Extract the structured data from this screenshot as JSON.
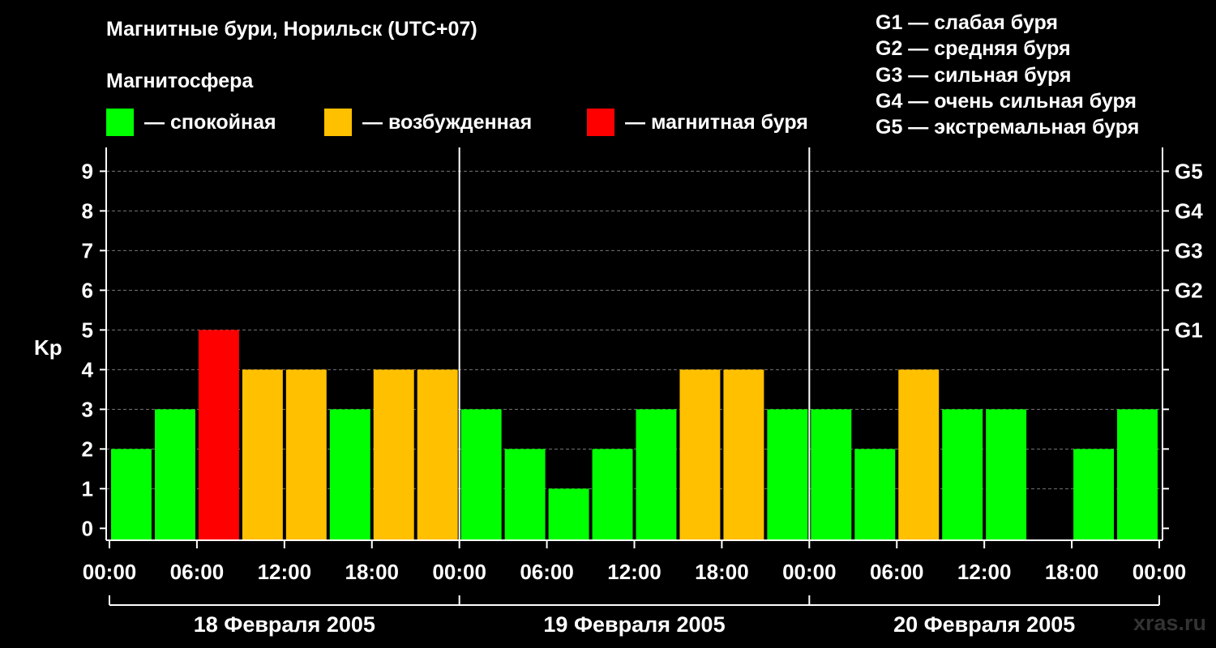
{
  "title": "Магнитные бури, Норильск (UTC+07)",
  "legend": {
    "title": "Магнитосфера",
    "items": [
      {
        "label": "— спокойная",
        "color": "#00ff00"
      },
      {
        "label": "— возбужденная",
        "color": "#ffc000"
      },
      {
        "label": "— магнитная буря",
        "color": "#ff0000"
      }
    ]
  },
  "storm_levels": [
    "G1 — слабая буря",
    "G2 — средняя буря",
    "G3 — сильная буря",
    "G4 — очень сильная буря",
    "G5 — экстремальная буря"
  ],
  "watermark": "xras.ru",
  "chart_data": {
    "type": "bar",
    "ylabel": "Kp",
    "ylim": [
      -0.3,
      9.6
    ],
    "y_ticks": [
      "0",
      "1",
      "2",
      "3",
      "4",
      "5",
      "6",
      "7",
      "8",
      "9"
    ],
    "right_ticks": [
      {
        "value": 5,
        "label": "G1"
      },
      {
        "value": 6,
        "label": "G2"
      },
      {
        "value": 7,
        "label": "G3"
      },
      {
        "value": 8,
        "label": "G4"
      },
      {
        "value": 9,
        "label": "G5"
      }
    ],
    "x_ticks": [
      "00:00",
      "06:00",
      "12:00",
      "18:00",
      "00:00",
      "06:00",
      "12:00",
      "18:00",
      "00:00",
      "06:00",
      "12:00",
      "18:00",
      "00:00"
    ],
    "days": [
      "18 Февраля 2005",
      "19 Февраля 2005",
      "20 Февраля 2005"
    ],
    "hours_per_bar": 3,
    "values": [
      2,
      3,
      5,
      4,
      4,
      3,
      4,
      4,
      3,
      2,
      1,
      2,
      3,
      4,
      4,
      3,
      3,
      2,
      4,
      3,
      3,
      null,
      2,
      3
    ],
    "colors": {
      "quiet": "#00ff00",
      "active": "#ffc000",
      "storm": "#ff0000"
    },
    "grid": "dashed horizontal"
  }
}
